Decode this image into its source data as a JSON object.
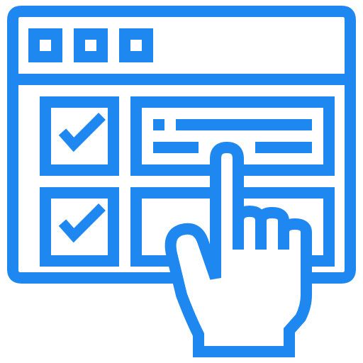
{
  "colors": {
    "stroke": "#1e88f0",
    "background": "#ffffff"
  },
  "icon": {
    "name": "browser-checklist-click-icon",
    "window": {
      "titlebar_dots": 3
    },
    "rows": [
      {
        "checked": true
      },
      {
        "checked": true
      }
    ]
  }
}
